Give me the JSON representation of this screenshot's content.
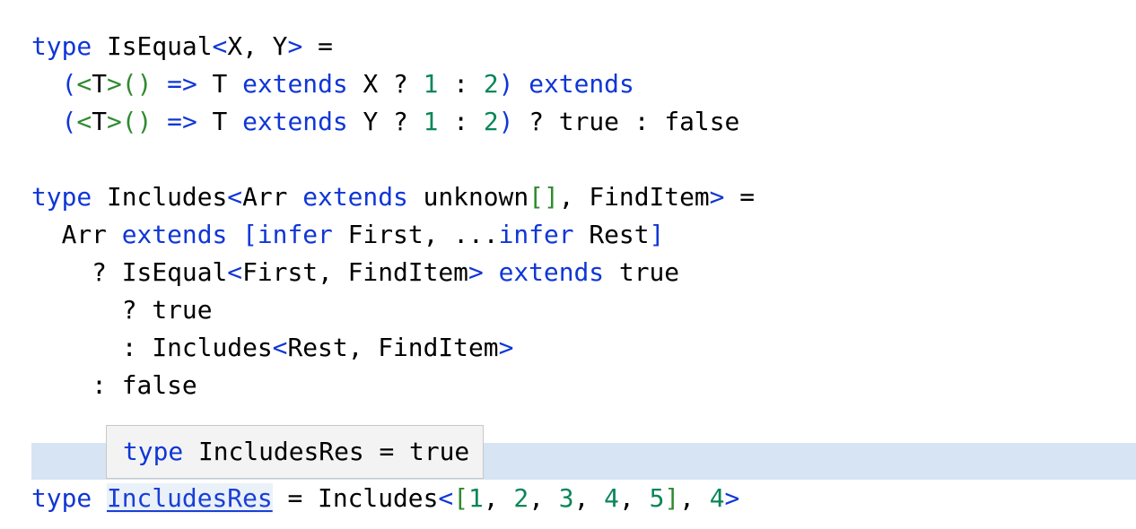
{
  "editor": {
    "language": "typescript",
    "colors": {
      "keyword": "#0f36d6",
      "bracket": "#2f8a2f",
      "number": "#098658",
      "text": "#000000",
      "line_highlight": "#d6e4f3",
      "tooltip_bg": "#f3f3f3",
      "tooltip_border": "#c8c8c8"
    },
    "lines": [
      [
        [
          "kw",
          "type"
        ],
        [
          "txt",
          " IsEqual"
        ],
        [
          "ang",
          "<"
        ],
        [
          "txt",
          "X, Y"
        ],
        [
          "ang",
          ">"
        ],
        [
          "txt",
          " ="
        ]
      ],
      [
        [
          "txt",
          "  "
        ],
        [
          "kw",
          "("
        ],
        [
          "br",
          "<"
        ],
        [
          "txt",
          "T"
        ],
        [
          "br",
          ">"
        ],
        [
          "br",
          "()"
        ],
        [
          "txt",
          " "
        ],
        [
          "kw",
          "=>"
        ],
        [
          "txt",
          " T "
        ],
        [
          "kw",
          "extends"
        ],
        [
          "txt",
          " X ? "
        ],
        [
          "num",
          "1"
        ],
        [
          "txt",
          " : "
        ],
        [
          "num",
          "2"
        ],
        [
          "kw",
          ")"
        ],
        [
          "txt",
          " "
        ],
        [
          "kw",
          "extends"
        ]
      ],
      [
        [
          "txt",
          "  "
        ],
        [
          "kw",
          "("
        ],
        [
          "br",
          "<"
        ],
        [
          "txt",
          "T"
        ],
        [
          "br",
          ">"
        ],
        [
          "br",
          "()"
        ],
        [
          "txt",
          " "
        ],
        [
          "kw",
          "=>"
        ],
        [
          "txt",
          " T "
        ],
        [
          "kw",
          "extends"
        ],
        [
          "txt",
          " Y ? "
        ],
        [
          "num",
          "1"
        ],
        [
          "txt",
          " : "
        ],
        [
          "num",
          "2"
        ],
        [
          "kw",
          ")"
        ],
        [
          "txt",
          " ? true : false"
        ]
      ],
      [],
      [
        [
          "kw",
          "type"
        ],
        [
          "txt",
          " Includes"
        ],
        [
          "ang",
          "<"
        ],
        [
          "txt",
          "Arr "
        ],
        [
          "kw",
          "extends"
        ],
        [
          "txt",
          " unknown"
        ],
        [
          "br",
          "[]"
        ],
        [
          "txt",
          ", FindItem"
        ],
        [
          "ang",
          ">"
        ],
        [
          "txt",
          " ="
        ]
      ],
      [
        [
          "txt",
          "  Arr "
        ],
        [
          "kw",
          "extends"
        ],
        [
          "txt",
          " "
        ],
        [
          "kw",
          "["
        ],
        [
          "kw",
          "infer"
        ],
        [
          "txt",
          " First, ..."
        ],
        [
          "kw",
          "infer"
        ],
        [
          "txt",
          " Rest"
        ],
        [
          "kw",
          "]"
        ]
      ],
      [
        [
          "txt",
          "    ? IsEqual"
        ],
        [
          "ang",
          "<"
        ],
        [
          "txt",
          "First, FindItem"
        ],
        [
          "ang",
          ">"
        ],
        [
          "txt",
          " "
        ],
        [
          "kw",
          "extends"
        ],
        [
          "txt",
          " true"
        ]
      ],
      [
        [
          "txt",
          "      ? true"
        ]
      ],
      [
        [
          "txt",
          "      : Includes"
        ],
        [
          "ang",
          "<"
        ],
        [
          "txt",
          "Rest, FindItem"
        ],
        [
          "ang",
          ">"
        ]
      ],
      [
        [
          "txt",
          "    : false"
        ]
      ],
      [],
      [
        [
          "kw",
          "type"
        ],
        [
          "txt",
          " "
        ],
        [
          "hover",
          "IncludesRes"
        ],
        [
          "txt",
          " = Includes"
        ],
        [
          "ang",
          "<"
        ],
        [
          "br",
          "["
        ],
        [
          "num",
          "1"
        ],
        [
          "txt",
          ", "
        ],
        [
          "num",
          "2"
        ],
        [
          "txt",
          ", "
        ],
        [
          "num",
          "3"
        ],
        [
          "txt",
          ", "
        ],
        [
          "num",
          "4"
        ],
        [
          "txt",
          ", "
        ],
        [
          "num",
          "5"
        ],
        [
          "br",
          "]"
        ],
        [
          "txt",
          ", "
        ],
        [
          "num",
          "4"
        ],
        [
          "ang",
          ">"
        ]
      ]
    ]
  },
  "tooltip": {
    "keyword": "type",
    "text": " IncludesRes = true"
  }
}
